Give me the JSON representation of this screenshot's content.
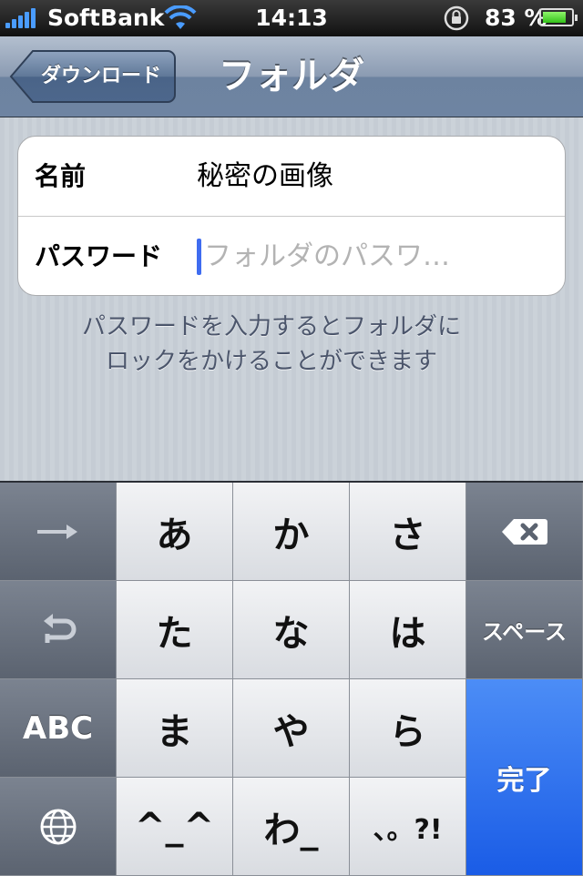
{
  "status_bar": {
    "carrier": "SoftBank",
    "time": "14:13",
    "battery_percent": "83 %",
    "battery_level": 0.83,
    "icons": [
      "signal-icon",
      "wifi-icon",
      "rotation-lock-icon",
      "battery-icon"
    ]
  },
  "nav": {
    "back_label": "ダウンロード",
    "title": "フォルダ"
  },
  "form": {
    "name_label": "名前",
    "name_value": "秘密の画像",
    "password_label": "パスワード",
    "password_placeholder": "フォルダのパスワ…",
    "note_line1": "パスワードを入力するとフォルダに",
    "note_line2": "ロックをかけることができます"
  },
  "keyboard": {
    "keys": {
      "k_a": "あ",
      "k_ka": "か",
      "k_sa": "さ",
      "k_ta": "た",
      "k_na": "な",
      "k_ha": "は",
      "k_ma": "ま",
      "k_ya": "や",
      "k_ra": "ら",
      "k_emoji": "^_^",
      "k_wa": "わ_",
      "k_punct": "、。?!",
      "abc": "ABC",
      "space": "スペース",
      "done": "完了"
    },
    "icons": [
      "arrow-right-icon",
      "undo-icon",
      "globe-icon",
      "delete-icon"
    ],
    "accent_color": "#2b6ff0"
  }
}
